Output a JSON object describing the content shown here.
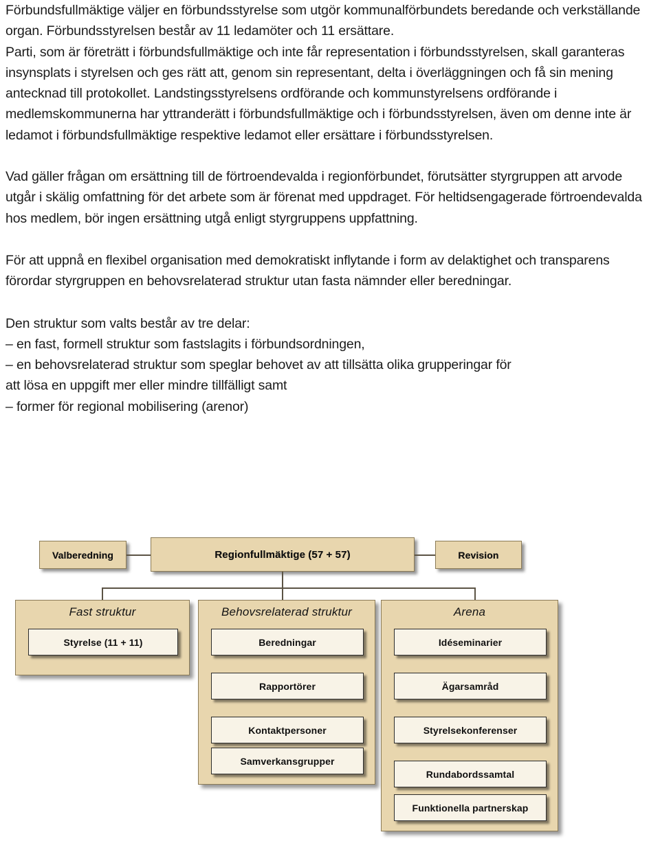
{
  "document": {
    "paragraphs": [
      "Förbundsfullmäktige väljer en förbundsstyrelse som utgör kommunalförbundets beredande och verkställande organ. Förbundsstyrelsen består av 11 ledamöter och 11 ersättare.",
      "Parti, som är företrätt i förbundsfullmäktige och inte får representation i förbundsstyrelsen, skall garanteras insynsplats i styrelsen och ges rätt att, genom sin representant, delta i överläggningen och få sin mening antecknad till protokollet. Landstingsstyrelsens ordförande och kommunstyrelsens ordförande i medlemskommunerna har yttranderätt i förbundsfullmäktige och i förbundsstyrelsen, även om denne inte är ledamot i förbundsfullmäktige respektive ledamot eller ersättare i förbundsstyrelsen.",
      "Vad gäller frågan om ersättning till de förtroendevalda i regionförbundet, förutsätter styrgruppen att arvode utgår i skälig omfattning för det arbete som är förenat med uppdraget. För heltidsengagerade förtroendevalda hos medlem, bör ingen ersättning utgå enligt styrgruppens uppfattning.",
      "För att uppnå en flexibel organisation med demokratiskt inflytande i form av delaktighet och transparens förordar styrgruppen en behovsrelaterad struktur utan fasta nämnder eller beredningar."
    ],
    "list_intro": "Den struktur som valts består av tre delar:",
    "list_items": [
      "– en fast, formell struktur som fastslagits i förbundsordningen,",
      "– en behovsrelaterad struktur som speglar behovet av att tillsätta olika grupperingar för",
      "att lösa en uppgift mer eller mindre tillfälligt samt",
      "– former för regional mobilisering (arenor)"
    ]
  },
  "diagram": {
    "top_left_box": "Valberedning",
    "top_center_box": "Regionfullmäktige (57 + 57)",
    "top_right_box": "Revision",
    "panels": [
      {
        "title": "Fast struktur",
        "items": [
          "Styrelse (11 + 11)"
        ]
      },
      {
        "title": "Behovsrelaterad struktur",
        "items": [
          "Beredningar",
          "Rapportörer",
          "Kontaktpersoner",
          "Samverkansgrupper"
        ]
      },
      {
        "title": "Arena",
        "items": [
          "Idéseminarier",
          "Ägarsamråd",
          "Styrelsekonferenser",
          "Rundabordssamtal",
          "Funktionella partnerskap"
        ]
      }
    ],
    "colors": {
      "panel_fill": "#E8D6AE",
      "panel_border": "#8A7A56",
      "item_fill": "#F8F3E7",
      "item_border": "#2B2B2B",
      "connector": "#5B5344"
    }
  }
}
